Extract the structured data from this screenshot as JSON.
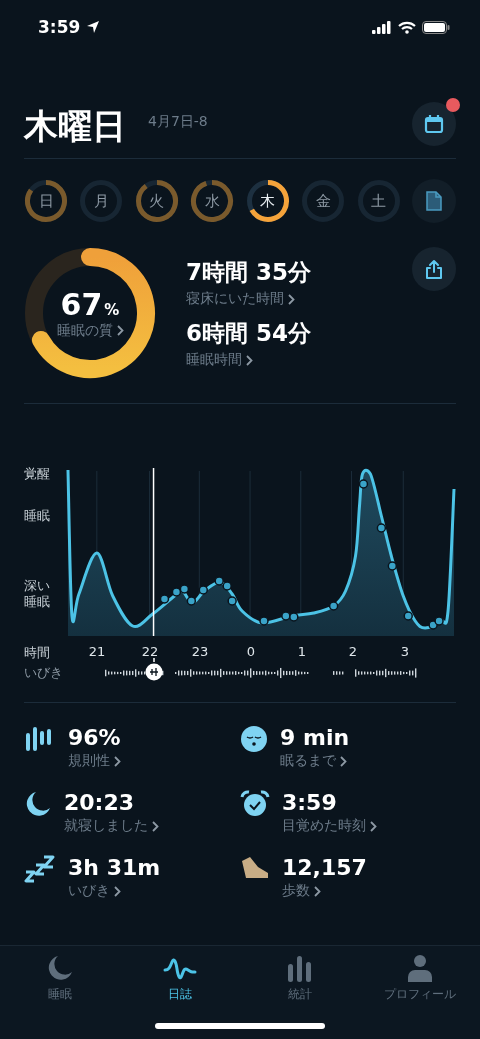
{
  "status_bar": {
    "time": "3:59"
  },
  "header": {
    "title": "木曜日",
    "date": "4月7日-8",
    "notification": true
  },
  "days": [
    {
      "label": "日",
      "selected": false
    },
    {
      "label": "月",
      "selected": false
    },
    {
      "label": "火",
      "selected": false
    },
    {
      "label": "水",
      "selected": false
    },
    {
      "label": "木",
      "selected": true
    },
    {
      "label": "金",
      "selected": false
    },
    {
      "label": "土",
      "selected": false
    }
  ],
  "summary": {
    "quality": {
      "value": "67",
      "unit": "%",
      "label": "睡眠の質"
    },
    "metrics": [
      {
        "value": "7時間 35分",
        "label": "寝床にいた時間"
      },
      {
        "value": "6時間 54分",
        "label": "睡眠時間"
      }
    ]
  },
  "sleep_graph": {
    "stage_labels": [
      "覚醒",
      "睡眠",
      "深い睡眠"
    ],
    "time_label": "時間",
    "hours": [
      "21",
      "22",
      "23",
      "0",
      "1",
      "2",
      "3"
    ],
    "snore_label": "いびき"
  },
  "stats": [
    {
      "kind": "regularity",
      "value": "96%",
      "label": "規則性"
    },
    {
      "kind": "latency",
      "value": "9 min",
      "label": "眠るまで"
    },
    {
      "kind": "bedtime",
      "value": "20:23",
      "label": "就寝しました"
    },
    {
      "kind": "wake",
      "value": "3:59",
      "label": "目覚めた時刻"
    },
    {
      "kind": "snore",
      "value": "3h 31m",
      "label": "いびき"
    },
    {
      "kind": "steps",
      "value": "12,157",
      "label": "歩数"
    }
  ],
  "tabs": [
    {
      "kind": "sleep",
      "label": "睡眠",
      "selected": false
    },
    {
      "kind": "journal",
      "label": "日誌",
      "selected": true
    },
    {
      "kind": "stats",
      "label": "統計",
      "selected": false
    },
    {
      "kind": "profile",
      "label": "プロフィール",
      "selected": false
    }
  ]
}
